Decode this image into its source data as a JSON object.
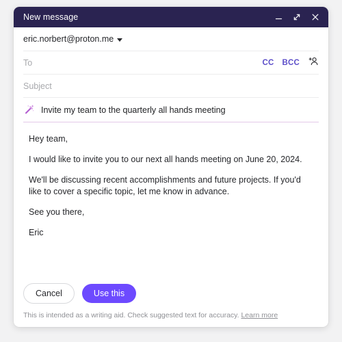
{
  "window": {
    "title": "New message",
    "controls": [
      {
        "name": "minimize",
        "label": "Minimize"
      },
      {
        "name": "maximize",
        "label": "Expand"
      },
      {
        "name": "close",
        "label": "Close"
      }
    ]
  },
  "compose": {
    "sender": {
      "address": "eric.norbert@proton.me"
    },
    "to": {
      "placeholder": "To",
      "value": "",
      "cc_label": "CC",
      "bcc_label": "BCC",
      "contacts_icon": "add-contact-icon"
    },
    "subject": {
      "placeholder": "Subject",
      "value": ""
    },
    "suggestion": {
      "icon": "magic-wand-icon",
      "prompt": "Invite my team to the quarterly all hands meeting"
    },
    "body": {
      "paragraphs": [
        "Hey team,",
        "I would like to invite you to our next all hands meeting on June 20, 2024.",
        "We'll be discussing recent accomplishments and future projects. If you'd like to cover a specific topic, let me know in advance.",
        "See you there,",
        "Eric"
      ]
    },
    "footer": {
      "cancel_label": "Cancel",
      "use_this_label": "Use this",
      "disclaimer_text": "This is intended as a writing aid. Check suggested text for accuracy.",
      "learn_more_label": "Learn more"
    }
  },
  "colors": {
    "titlebar_background": "#2a2351",
    "accent_purple": "#6d4aff",
    "link_purple": "#5c4ec9",
    "suggestion_underline": "#e3c8e8",
    "page_background": "#f2f2f3"
  }
}
